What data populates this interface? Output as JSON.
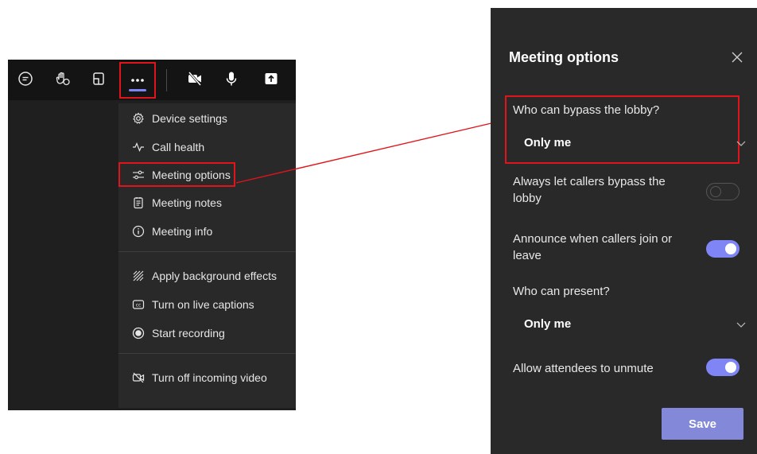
{
  "toolbar": {
    "icons": [
      "chat-icon",
      "raise-hand-icon",
      "rooms-icon",
      "more-actions-icon",
      "camera-off-icon",
      "microphone-icon",
      "share-screen-icon"
    ]
  },
  "menu": {
    "items": [
      {
        "label": "Device settings",
        "icon": "gear-icon"
      },
      {
        "label": "Call health",
        "icon": "pulse-icon"
      },
      {
        "label": "Meeting options",
        "icon": "sliders-icon"
      },
      {
        "label": "Meeting notes",
        "icon": "notes-icon"
      },
      {
        "label": "Meeting info",
        "icon": "info-icon"
      },
      {
        "label": "Apply background effects",
        "icon": "background-effects-icon"
      },
      {
        "label": "Turn on live captions",
        "icon": "captions-icon"
      },
      {
        "label": "Start recording",
        "icon": "record-icon"
      },
      {
        "label": "Turn off incoming video",
        "icon": "video-off-icon"
      }
    ]
  },
  "panel": {
    "title": "Meeting options",
    "lobby_label": "Who can bypass the lobby?",
    "lobby_value": "Only me",
    "callers_bypass_label": "Always let callers bypass the lobby",
    "callers_bypass_on": false,
    "announce_label": "Announce when callers join or leave",
    "announce_on": true,
    "present_label": "Who can present?",
    "present_value": "Only me",
    "unmute_label": "Allow attendees to unmute",
    "unmute_on": true,
    "save_label": "Save"
  },
  "colors": {
    "accent": "#7f85f5",
    "highlight": "#e0141b",
    "save_button": "#8389d8"
  }
}
